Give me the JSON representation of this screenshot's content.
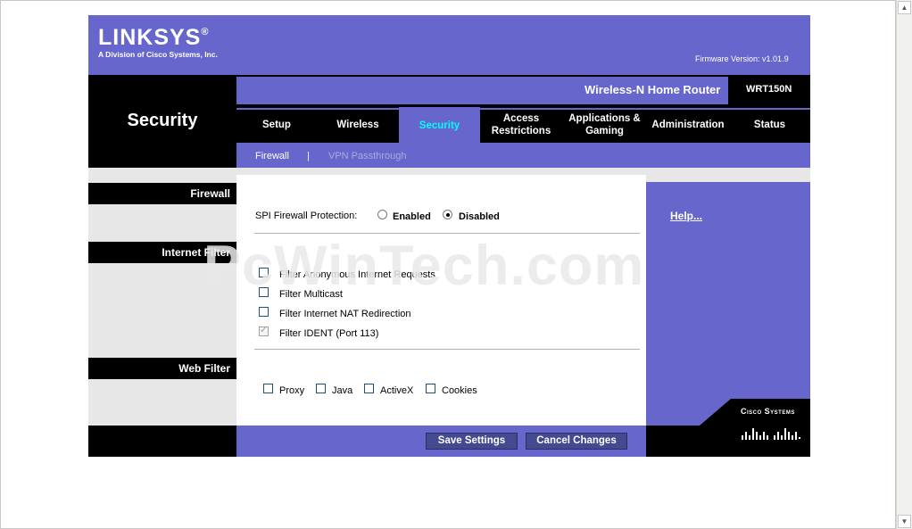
{
  "brand": {
    "logo": "LINKSYS",
    "registered": "®",
    "subtitle": "A Division of Cisco Systems, Inc.",
    "firmware_label": "Firmware Version:",
    "firmware_value": "v1.01.9",
    "cisco_text": "Cisco Systems"
  },
  "product": {
    "name": "Wireless-N Home Router",
    "model": "WRT150N"
  },
  "page_title": "Security",
  "tabs": [
    {
      "label": "Setup"
    },
    {
      "label": "Wireless"
    },
    {
      "label": "Security"
    },
    {
      "label": "Access Restrictions"
    },
    {
      "label": "Applications & Gaming"
    },
    {
      "label": "Administration"
    },
    {
      "label": "Status"
    }
  ],
  "subtabs": {
    "firewall": "Firewall",
    "separator": "|",
    "vpn": "VPN Passthrough"
  },
  "sections": {
    "firewall": "Firewall",
    "internet_filter": "Internet Filter",
    "web_filter": "Web Filter"
  },
  "firewall": {
    "spi_label": "SPI Firewall Protection:",
    "enabled_label": "Enabled",
    "disabled_label": "Disabled",
    "selected": "Disabled"
  },
  "internet_filter": {
    "items": [
      {
        "label": "Filter Anonymous Internet Requests",
        "checked": false
      },
      {
        "label": "Filter Multicast",
        "checked": false
      },
      {
        "label": "Filter Internet NAT Redirection",
        "checked": false
      },
      {
        "label": "Filter IDENT (Port 113)",
        "checked": true
      }
    ]
  },
  "web_filter": {
    "items": [
      {
        "label": "Proxy"
      },
      {
        "label": "Java"
      },
      {
        "label": "ActiveX"
      },
      {
        "label": "Cookies"
      }
    ]
  },
  "help_link": "Help...",
  "buttons": {
    "save": "Save Settings",
    "cancel": "Cancel Changes"
  },
  "watermark": "PcWinTech.com",
  "colors": {
    "purple": "#6666cc",
    "black": "#000000",
    "active_tab_text": "#00ffff",
    "button": "#434a8f"
  }
}
